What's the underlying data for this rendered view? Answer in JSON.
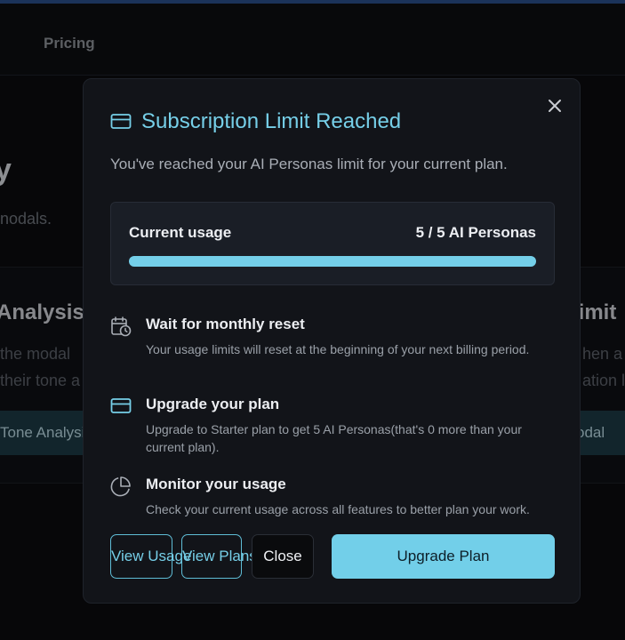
{
  "background": {
    "nav_link": "Pricing",
    "heading_fragment": "y",
    "sub_fragment": "nodals.",
    "card_left_title": "Analysis I",
    "card_right_title": ".imit",
    "card_left_line1": "the modal",
    "card_left_line2": "their tone a",
    "card_right_line1": "hen a",
    "card_right_line2": "ation l",
    "card_left_button": "Tone Analysis",
    "card_right_button": "odal"
  },
  "modal": {
    "title": "Subscription Limit Reached",
    "title_icon": "credit-card-icon",
    "subtitle": "You've reached your AI Personas limit for your current plan.",
    "usage": {
      "label": "Current usage",
      "value": "5 / 5 AI Personas",
      "progress_percent": 100
    },
    "options": [
      {
        "icon": "calendar-clock-icon",
        "title": "Wait for monthly reset",
        "description": "Your usage limits will reset at the beginning of your next billing period."
      },
      {
        "icon": "credit-card-icon",
        "title": "Upgrade your plan",
        "description": "Upgrade to Starter plan to get 5 AI Personas(that's 0 more than your current plan)."
      },
      {
        "icon": "pie-chart-icon",
        "title": "Monitor your usage",
        "description": "Check your current usage across all features to better plan your work."
      }
    ],
    "buttons": {
      "view_usage": "View Usage",
      "view_plans": "View Plans",
      "close": "Close",
      "upgrade": "Upgrade Plan"
    }
  },
  "colors": {
    "accent": "#76cfe8",
    "modal_bg": "#121419",
    "page_bg": "#0b0c0f"
  }
}
